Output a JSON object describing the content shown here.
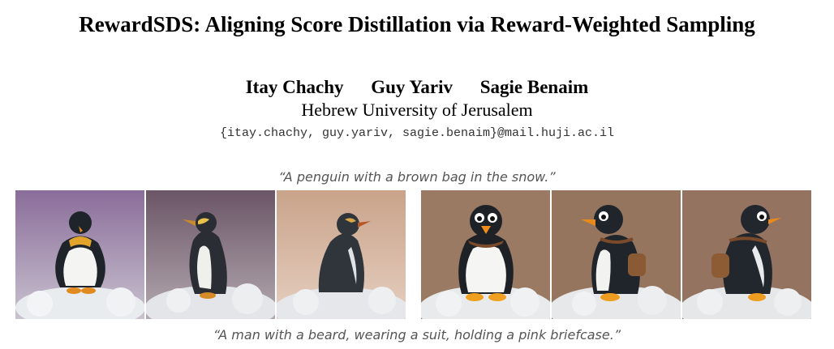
{
  "paper": {
    "title": "RewardSDS: Aligning Score Distillation via Reward-Weighted Sampling",
    "authors": [
      "Itay Chachy",
      "Guy Yariv",
      "Sagie Benaim"
    ],
    "affiliation": "Hebrew University of Jerusalem",
    "email": "{itay.chachy, guy.yariv, sagie.benaim}@mail.huji.ac.il"
  },
  "figure": {
    "prompt_1": "“A penguin with a brown bag in the snow.”",
    "prompt_2": "“A man with a beard, wearing a suit, holding a pink briefcase.”"
  }
}
